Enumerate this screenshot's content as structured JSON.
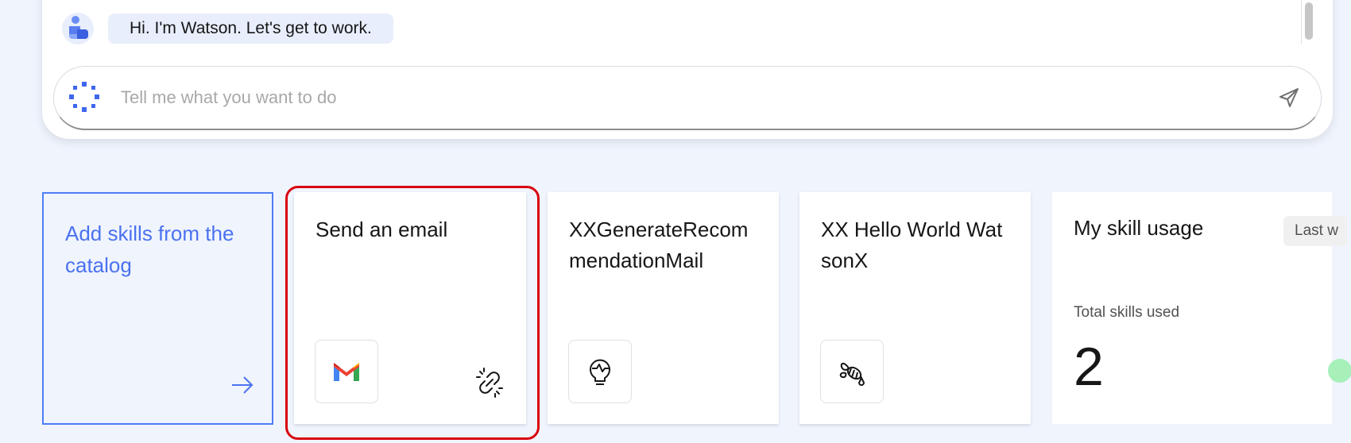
{
  "chat": {
    "greeting": "Hi. I'm Watson. Let's get to work.",
    "input_placeholder": "Tell me what you want to do"
  },
  "cards": {
    "catalog_label": "Add skills from the catalog",
    "skill1_title": "Send an email",
    "skill2_title": "XXGenerateRecommendationMail",
    "skill3_title": "XX Hello World WatsonX"
  },
  "usage": {
    "title": "My skill usage",
    "period": "Last w",
    "subtitle": "Total skills used",
    "count": "2"
  },
  "colors": {
    "accent": "#4a72f0",
    "highlight": "#d9020f",
    "background": "#f0f4fd"
  },
  "icons": {
    "avatar": "watson-avatar-icon",
    "spinner": "loading-dots-icon",
    "send": "send-icon",
    "arrow": "arrow-right-icon",
    "skill1": "gmail-icon",
    "skill1_status": "unlink-icon",
    "skill2": "lightbulb-icon",
    "skill3": "bee-icon"
  }
}
